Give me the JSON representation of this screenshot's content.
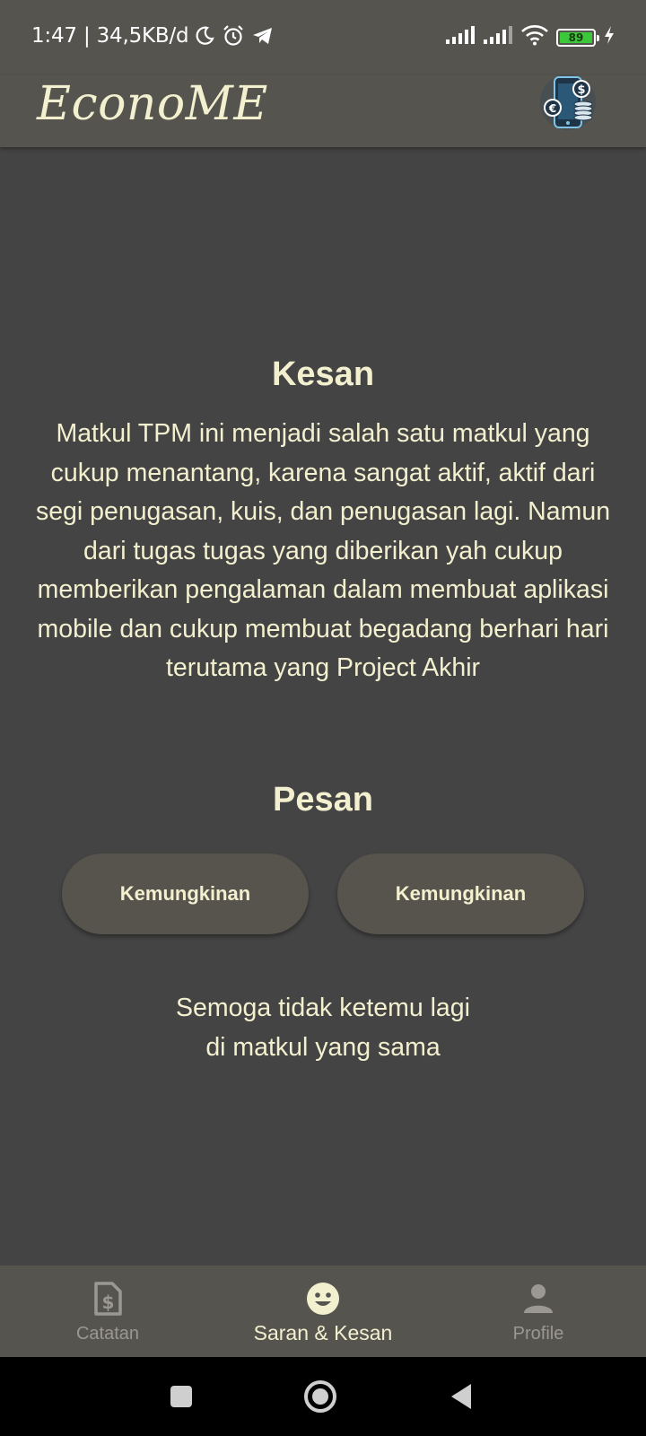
{
  "status_bar": {
    "time_info": "1:47 | 34,5KB/d",
    "battery_level": "89",
    "icons": [
      "moon-icon",
      "alarm-icon",
      "telegram-icon",
      "signal-icon",
      "signal-icon",
      "wifi-icon",
      "battery-icon",
      "charging-icon"
    ]
  },
  "app_bar": {
    "title": "EconoME",
    "logo_icon": "money-phone-logo"
  },
  "main": {
    "kesan_heading": "Kesan",
    "kesan_text": "Matkul TPM ini menjadi salah satu matkul yang cukup menantang, karena sangat aktif, aktif dari segi penugasan, kuis, dan penugasan lagi. Namun dari tugas tugas yang diberikan yah cukup memberikan pengalaman dalam membuat aplikasi mobile dan cukup membuat begadang berhari hari terutama yang Project Akhir",
    "pesan_heading": "Pesan",
    "buttons": [
      {
        "label": "Kemungkinan"
      },
      {
        "label": "Kemungkinan"
      }
    ],
    "closing_line1": "Semoga tidak ketemu lagi",
    "closing_line2": "di matkul yang sama"
  },
  "bottom_nav": {
    "items": [
      {
        "label": "Catatan",
        "icon": "receipt-dollar-icon",
        "active": false
      },
      {
        "label": "Saran & Kesan",
        "icon": "smiley-icon",
        "active": true
      },
      {
        "label": "Profile",
        "icon": "person-icon",
        "active": false
      }
    ]
  },
  "colors": {
    "background": "#444444",
    "bar": "#55544f",
    "text": "#f3f0cf",
    "inactive": "#9a9890",
    "battery": "#3cc83a"
  }
}
